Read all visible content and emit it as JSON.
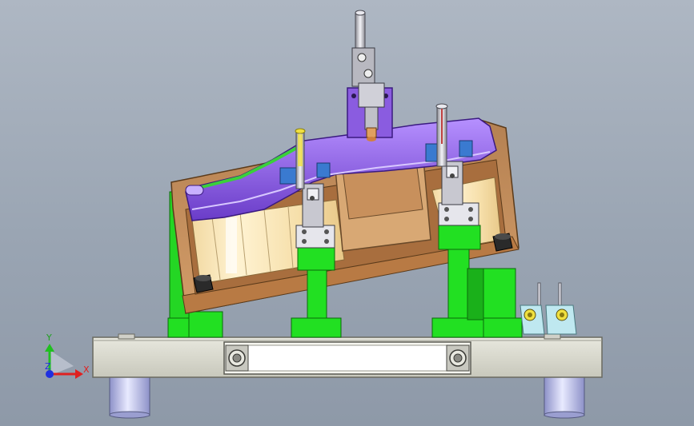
{
  "viewport": {
    "background_top": "#aeb7c3",
    "background_bottom": "#8e99a8"
  },
  "triad": {
    "x_label": "X",
    "y_label": "Y",
    "z_label": "Z",
    "x_color": "#e02020",
    "y_color": "#20c020",
    "z_color": "#2030e0"
  },
  "model": {
    "base_plate_color": "#dcdcd0",
    "support_color": "#22e022",
    "fixture_body_color": "#c89060",
    "fixture_inner_color": "#f0d8a0",
    "part_color": "#8a5ce0",
    "clamp_color": "#c0c0c8",
    "locator_color": "#3a7ad0",
    "foot_color": "#b8bce8"
  }
}
